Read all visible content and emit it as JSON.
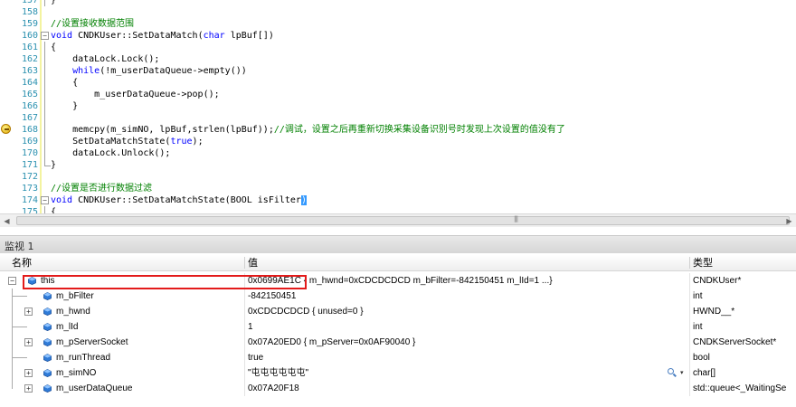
{
  "editor": {
    "lines": [
      {
        "num": "157",
        "text": "}",
        "fold": "",
        "guide": "line"
      },
      {
        "num": "158",
        "text": "",
        "fold": "",
        "guide": ""
      },
      {
        "num": "159",
        "text": "//设置接收数据范围",
        "fold": "",
        "guide": "",
        "kind": "comment"
      },
      {
        "num": "160",
        "text": "void CNDKUser::SetDataMatch(char lpBuf[])",
        "fold": "-",
        "guide": "",
        "kind": "decl"
      },
      {
        "num": "161",
        "text": "{",
        "fold": "",
        "guide": "line"
      },
      {
        "num": "162",
        "text": "    dataLock.Lock();",
        "fold": "",
        "guide": "line"
      },
      {
        "num": "163",
        "text": "    while(!m_userDataQueue->empty())",
        "fold": "",
        "guide": "line",
        "kind": "while"
      },
      {
        "num": "164",
        "text": "    {",
        "fold": "",
        "guide": "line"
      },
      {
        "num": "165",
        "text": "        m_userDataQueue->pop();",
        "fold": "",
        "guide": "line"
      },
      {
        "num": "166",
        "text": "    }",
        "fold": "",
        "guide": "line"
      },
      {
        "num": "167",
        "text": "",
        "fold": "",
        "guide": "line"
      },
      {
        "num": "168",
        "text": "    memcpy(m_simNO, lpBuf,strlen(lpBuf));//调试，设置之后再重新切换采集设备识别号时发现上次设置的值没有了",
        "fold": "",
        "guide": "line",
        "kind": "memcpy"
      },
      {
        "num": "169",
        "text": "    SetDataMatchState(true);",
        "fold": "",
        "guide": "line",
        "kind": "settrue"
      },
      {
        "num": "170",
        "text": "    dataLock.Unlock();",
        "fold": "",
        "guide": "line"
      },
      {
        "num": "171",
        "text": "}",
        "fold": "",
        "guide": "end"
      },
      {
        "num": "172",
        "text": "",
        "fold": "",
        "guide": ""
      },
      {
        "num": "173",
        "text": "//设置是否进行数据过滤",
        "fold": "",
        "guide": "",
        "kind": "comment"
      },
      {
        "num": "174",
        "text": "void CNDKUser::SetDataMatchState(BOOL isFilter)",
        "fold": "-",
        "guide": "",
        "kind": "decl2"
      },
      {
        "num": "175",
        "text": "{",
        "fold": "",
        "guide": "line"
      }
    ]
  },
  "watch": {
    "title": "监视 1",
    "columns": {
      "name": "名称",
      "value": "值",
      "type": "类型"
    },
    "rows": [
      {
        "name": "this",
        "value": "0x0699AE1C",
        "extra": " { m_hwnd=0xCDCDCDCD m_bFilter=-842150451 m_lId=1 ...}",
        "type": "CNDKUser*",
        "expander": "-",
        "level": 0
      },
      {
        "name": "m_bFilter",
        "value": "-842150451",
        "extra": "",
        "type": "int",
        "expander": "",
        "level": 1
      },
      {
        "name": "m_hwnd",
        "value": "0xCDCDCDCD { unused=0 }",
        "extra": "",
        "type": "HWND__*",
        "expander": "+",
        "level": 1
      },
      {
        "name": "m_lId",
        "value": "1",
        "extra": "",
        "type": "int",
        "expander": "",
        "level": 1
      },
      {
        "name": "m_pServerSocket",
        "value": "0x07A20ED0 { m_pServer=0x0AF90040 }",
        "extra": "",
        "type": "CNDKServerSocket*",
        "expander": "+",
        "level": 1
      },
      {
        "name": "m_runThread",
        "value": "true",
        "extra": "",
        "type": "bool",
        "expander": "",
        "level": 1
      },
      {
        "name": "m_simNO",
        "value": "\"屯屯屯屯屯屯\"",
        "extra": "",
        "type": "char[]",
        "expander": "+",
        "level": 1
      },
      {
        "name": "m_userDataQueue",
        "value": "0x07A20F18",
        "extra": "",
        "type": "std::queue<_WaitingSe",
        "expander": "+",
        "level": 1
      }
    ]
  },
  "colors": {
    "comment": "#008000",
    "keyword": "#0000ff",
    "linenum": "#2b91af",
    "highlight": "#3399ff",
    "annotation": "#e31b1b"
  }
}
